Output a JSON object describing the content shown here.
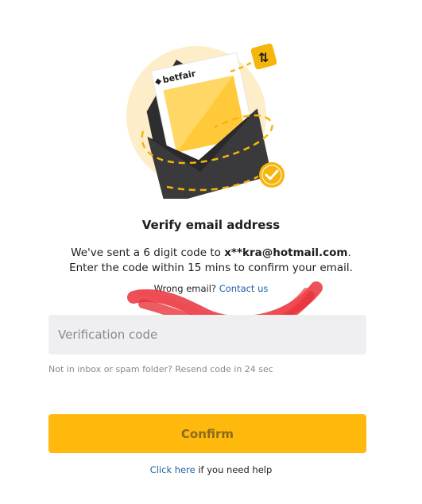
{
  "illustration": {
    "brand_text": "betfair",
    "icon": "envelope-icon",
    "badge_icon": "check-badge-icon",
    "tag_icon": "arrows-tag-icon"
  },
  "heading": {
    "title": "Verify email address"
  },
  "message": {
    "line1_prefix": "We've sent a 6 digit code to ",
    "email": "x**kra@hotmail.com",
    "line1_suffix": ".",
    "line2": "Enter the code within 15 mins to confirm your email."
  },
  "wrong_email": {
    "text": "Wrong email? ",
    "link": "Contact us"
  },
  "verification_input": {
    "placeholder": "Verification code",
    "value": ""
  },
  "resend": {
    "text": "Not in inbox or spam folder? Resend code in 24 sec"
  },
  "confirm_button": {
    "label": "Confirm"
  },
  "help": {
    "link": "Click here",
    "text": " if you need help"
  },
  "colors": {
    "accent": "#ffb80c",
    "link": "#1f5fa8",
    "input_bg": "#efeff1",
    "envelope": "#2e2e30",
    "scribble": "#e8323c"
  }
}
